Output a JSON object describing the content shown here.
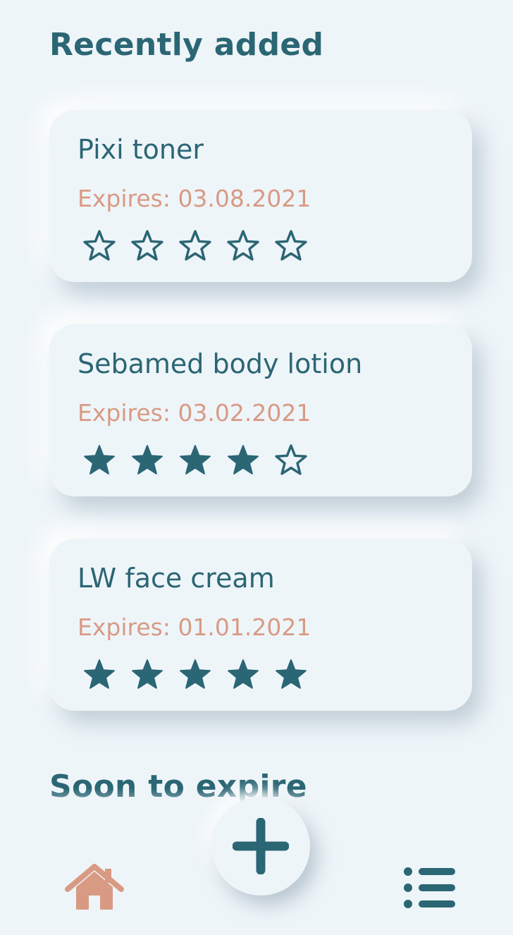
{
  "sections": {
    "recent_title": "Recently added",
    "soon_title": "Soon to expire"
  },
  "products": [
    {
      "name": "Pixi toner",
      "expires": "Expires: 03.08.2021",
      "rating": 0,
      "max_rating": 5
    },
    {
      "name": "Sebamed body lotion",
      "expires": "Expires: 03.02.2021",
      "rating": 4,
      "max_rating": 5
    },
    {
      "name": "LW face cream",
      "expires": "Expires: 01.01.2021",
      "rating": 5,
      "max_rating": 5
    }
  ],
  "nav": {
    "home_icon": "home-icon",
    "add_icon": "plus-icon",
    "list_icon": "list-icon"
  },
  "colors": {
    "background": "#eef5f9",
    "primary": "#2b6674",
    "accent": "#d99a84"
  }
}
